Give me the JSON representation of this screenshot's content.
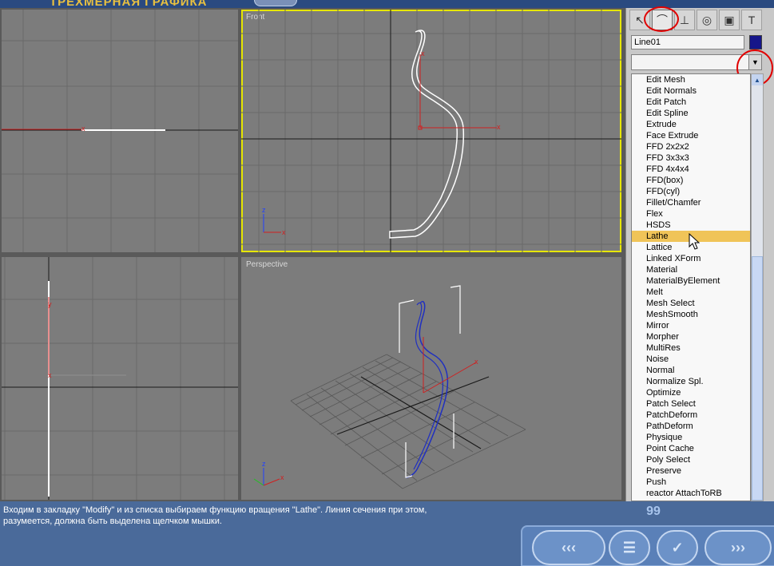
{
  "title": {
    "text": "ТРЕХМЕРНАЯ ГРАФИКА"
  },
  "viewports": {
    "top_left": {
      "label": ""
    },
    "front": {
      "label": "Front"
    },
    "bottom_left": {
      "label": ""
    },
    "perspective": {
      "label": "Perspective"
    }
  },
  "axis_labels": {
    "x": "x",
    "y": "y",
    "z": "z"
  },
  "command_panel": {
    "tabs": [
      {
        "icon": "create-arrow-icon"
      },
      {
        "icon": "modify-bend-icon"
      },
      {
        "icon": "hierarchy-icon"
      },
      {
        "icon": "motion-wheel-icon"
      },
      {
        "icon": "display-monitor-icon"
      },
      {
        "icon": "utilities-hammer-icon"
      }
    ],
    "object_name": "Line01",
    "object_color": "#16168a",
    "modifier_dropdown_value": "",
    "modifiers": [
      "Edit Mesh",
      "Edit Normals",
      "Edit Patch",
      "Edit Spline",
      "Extrude",
      "Face Extrude",
      "FFD 2x2x2",
      "FFD 3x3x3",
      "FFD 4x4x4",
      "FFD(box)",
      "FFD(cyl)",
      "Fillet/Chamfer",
      "Flex",
      "HSDS",
      "Lathe",
      "Lattice",
      "Linked XForm",
      "Material",
      "MaterialByElement",
      "Melt",
      "Mesh Select",
      "MeshSmooth",
      "Mirror",
      "Morpher",
      "MultiRes",
      "Noise",
      "Normal",
      "Normalize Spl.",
      "Optimize",
      "Patch Select",
      "PatchDeform",
      "PathDeform",
      "Physique",
      "Point Cache",
      "Poly Select",
      "Preserve",
      "Push",
      "reactor AttachToRB"
    ],
    "highlighted_modifier": "Lathe"
  },
  "caption": {
    "line1": "Входим в закладку \"Modify\" и из списка выбираем функцию вращения \"Lathe\". Линия сечения при этом,",
    "line2": "разумеется, должна быть выделена щелчком мышки."
  },
  "page_number": "99",
  "nav": {
    "first": "‹‹‹",
    "menu": "☰",
    "check": "✓",
    "next": "›››"
  },
  "colors": {
    "viewport_bg": "#7c7c7c",
    "active_border": "#e6e600",
    "highlight": "#f0c458",
    "annotation": "#e00000",
    "frame": "#4a6a9a"
  }
}
